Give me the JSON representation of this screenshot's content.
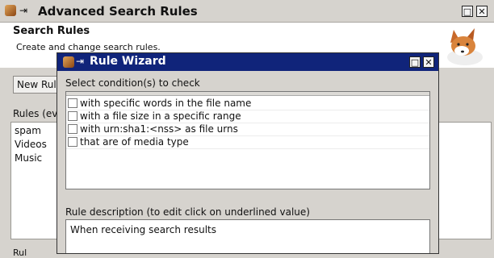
{
  "back_window": {
    "title": "Advanced Search Rules",
    "header_title": "Search Rules",
    "header_subtitle": "Create and change search rules.",
    "new_rule_button": "New Rule",
    "rules_label": "Rules (eva",
    "rules": [
      "spam",
      "Videos",
      "Music"
    ],
    "bottom_label": "Rul"
  },
  "dialog": {
    "title": "Rule Wizard",
    "select_label": "Select condition(s) to check",
    "conditions": [
      "with specific words in the file name",
      "with a file size in a specific range",
      "with urn:sha1:<nss> as file urns",
      "that are of media type"
    ],
    "description_label": "Rule description (to edit click on underlined value)",
    "description_text": "When receiving search results"
  },
  "icons": {
    "app": "fox-app-icon",
    "pin": "pin-icon",
    "maximize": "maximize-icon",
    "close": "close-icon"
  },
  "colors": {
    "dialog_titlebar": "#10247a",
    "window_bg": "#d6d3ce"
  }
}
